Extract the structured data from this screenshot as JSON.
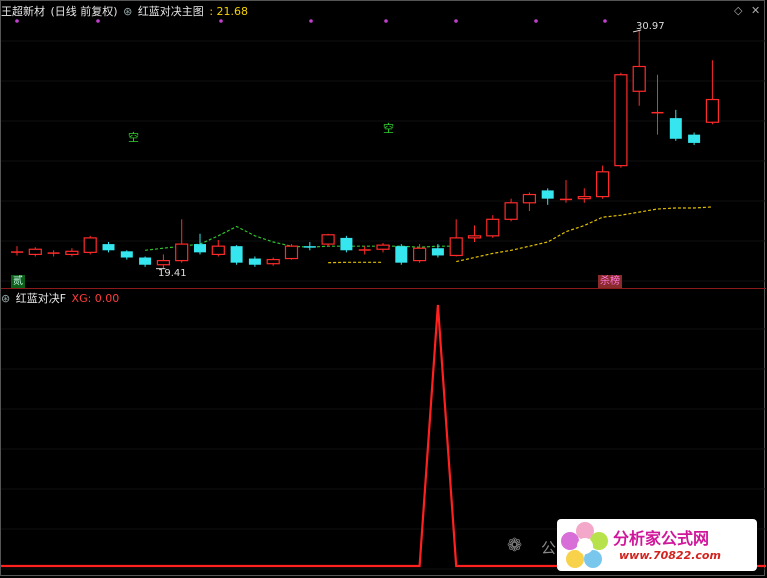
{
  "top_pane": {
    "stock_name": "王超新材",
    "period": "(日线 前复权)",
    "indicator_name": "红蓝对决主图",
    "indicator_value": ": 21.68",
    "price_high_label": "30.97",
    "price_low_label": "19.41",
    "empty_label": "空",
    "badge_left": "贰",
    "badge_right": "杀榜"
  },
  "bottom_pane": {
    "indicator_name": "红蓝对决F",
    "xg_value": "XG: 0.00"
  },
  "watermark": {
    "wechat_partial": "公",
    "site_name": "分析家公式网",
    "site_url": "www.70822.com"
  },
  "colors": {
    "up": "#ff2a2a",
    "down": "#35e6ee",
    "yellow_line": "#e0c000",
    "green_line": "#2fc02f",
    "signal": "#ff2020"
  },
  "chart_data": [
    {
      "type": "candlestick",
      "candles": [
        {
          "o": 20.25,
          "c": 20.25,
          "h": 20.5,
          "l": 20.05
        },
        {
          "o": 20.1,
          "c": 20.35,
          "h": 20.45,
          "l": 20.0
        },
        {
          "o": 20.15,
          "c": 20.2,
          "h": 20.3,
          "l": 20.0
        },
        {
          "o": 20.1,
          "c": 20.25,
          "h": 20.4,
          "l": 20.0
        },
        {
          "o": 20.2,
          "c": 20.9,
          "h": 21.0,
          "l": 20.1
        },
        {
          "o": 20.6,
          "c": 20.3,
          "h": 20.7,
          "l": 20.2
        },
        {
          "o": 20.25,
          "c": 19.95,
          "h": 20.3,
          "l": 19.85
        },
        {
          "o": 19.95,
          "c": 19.6,
          "h": 20.0,
          "l": 19.5
        },
        {
          "o": 19.6,
          "c": 19.8,
          "h": 20.1,
          "l": 19.41
        },
        {
          "o": 19.8,
          "c": 20.6,
          "h": 21.8,
          "l": 19.7
        },
        {
          "o": 20.6,
          "c": 20.2,
          "h": 21.1,
          "l": 20.1
        },
        {
          "o": 20.1,
          "c": 20.5,
          "h": 20.8,
          "l": 20.0
        },
        {
          "o": 20.5,
          "c": 19.7,
          "h": 20.55,
          "l": 19.6
        },
        {
          "o": 19.9,
          "c": 19.6,
          "h": 20.0,
          "l": 19.5
        },
        {
          "o": 19.65,
          "c": 19.85,
          "h": 19.95,
          "l": 19.55
        },
        {
          "o": 19.9,
          "c": 20.5,
          "h": 20.6,
          "l": 19.85
        },
        {
          "o": 20.5,
          "c": 20.45,
          "h": 20.7,
          "l": 20.3
        },
        {
          "o": 20.6,
          "c": 21.05,
          "h": 21.1,
          "l": 20.5
        },
        {
          "o": 20.9,
          "c": 20.3,
          "h": 21.0,
          "l": 20.2
        },
        {
          "o": 20.3,
          "c": 20.35,
          "h": 20.5,
          "l": 20.1
        },
        {
          "o": 20.35,
          "c": 20.55,
          "h": 20.65,
          "l": 20.2
        },
        {
          "o": 20.5,
          "c": 19.7,
          "h": 20.6,
          "l": 19.6
        },
        {
          "o": 19.8,
          "c": 20.4,
          "h": 20.6,
          "l": 19.7
        },
        {
          "o": 20.4,
          "c": 20.05,
          "h": 20.6,
          "l": 19.95
        },
        {
          "o": 20.05,
          "c": 20.9,
          "h": 21.8,
          "l": 20.0
        },
        {
          "o": 20.9,
          "c": 21.0,
          "h": 21.5,
          "l": 20.7
        },
        {
          "o": 21.0,
          "c": 21.8,
          "h": 22.0,
          "l": 20.9
        },
        {
          "o": 21.8,
          "c": 22.6,
          "h": 22.8,
          "l": 21.7
        },
        {
          "o": 22.6,
          "c": 23.0,
          "h": 23.1,
          "l": 22.2
        },
        {
          "o": 23.2,
          "c": 22.8,
          "h": 23.3,
          "l": 22.5
        },
        {
          "o": 22.8,
          "c": 22.8,
          "h": 23.7,
          "l": 22.6
        },
        {
          "o": 22.8,
          "c": 22.9,
          "h": 23.3,
          "l": 22.6
        },
        {
          "o": 22.9,
          "c": 24.1,
          "h": 24.4,
          "l": 22.8
        },
        {
          "o": 24.4,
          "c": 28.8,
          "h": 28.9,
          "l": 24.3
        },
        {
          "o": 28.0,
          "c": 29.2,
          "h": 30.97,
          "l": 27.3
        },
        {
          "o": 27.0,
          "c": 27.0,
          "h": 28.8,
          "l": 25.9
        },
        {
          "o": 26.7,
          "c": 25.7,
          "h": 27.1,
          "l": 25.6
        },
        {
          "o": 25.9,
          "c": 25.5,
          "h": 26.0,
          "l": 25.4
        },
        {
          "o": 26.5,
          "c": 27.6,
          "h": 29.5,
          "l": 26.4
        }
      ],
      "yellow_line": [
        null,
        null,
        null,
        null,
        null,
        null,
        null,
        null,
        null,
        null,
        null,
        null,
        null,
        null,
        null,
        null,
        null,
        19.7,
        19.72,
        19.72,
        19.72,
        null,
        null,
        null,
        19.75,
        19.95,
        20.15,
        20.3,
        20.5,
        20.7,
        21.2,
        21.5,
        21.9,
        22.0,
        22.15,
        22.3,
        22.35,
        22.35,
        22.4
      ],
      "green_line": [
        null,
        null,
        null,
        null,
        null,
        null,
        null,
        20.3,
        20.4,
        20.5,
        20.6,
        21.0,
        21.45,
        21.0,
        20.7,
        20.5,
        20.45,
        20.5,
        20.5,
        20.5,
        20.5,
        20.5,
        20.45,
        20.5,
        20.5
      ]
    },
    {
      "type": "line",
      "name": "XG",
      "values": [
        0,
        0,
        0,
        0,
        0,
        0,
        0,
        0,
        0,
        0,
        0,
        0,
        0,
        0,
        0,
        0,
        0,
        0,
        0,
        0,
        0,
        0,
        0,
        1,
        0,
        0,
        0,
        0,
        0,
        0,
        0,
        0,
        0,
        0,
        0,
        0,
        0,
        0,
        0
      ],
      "ylim": [
        0,
        1
      ]
    }
  ]
}
